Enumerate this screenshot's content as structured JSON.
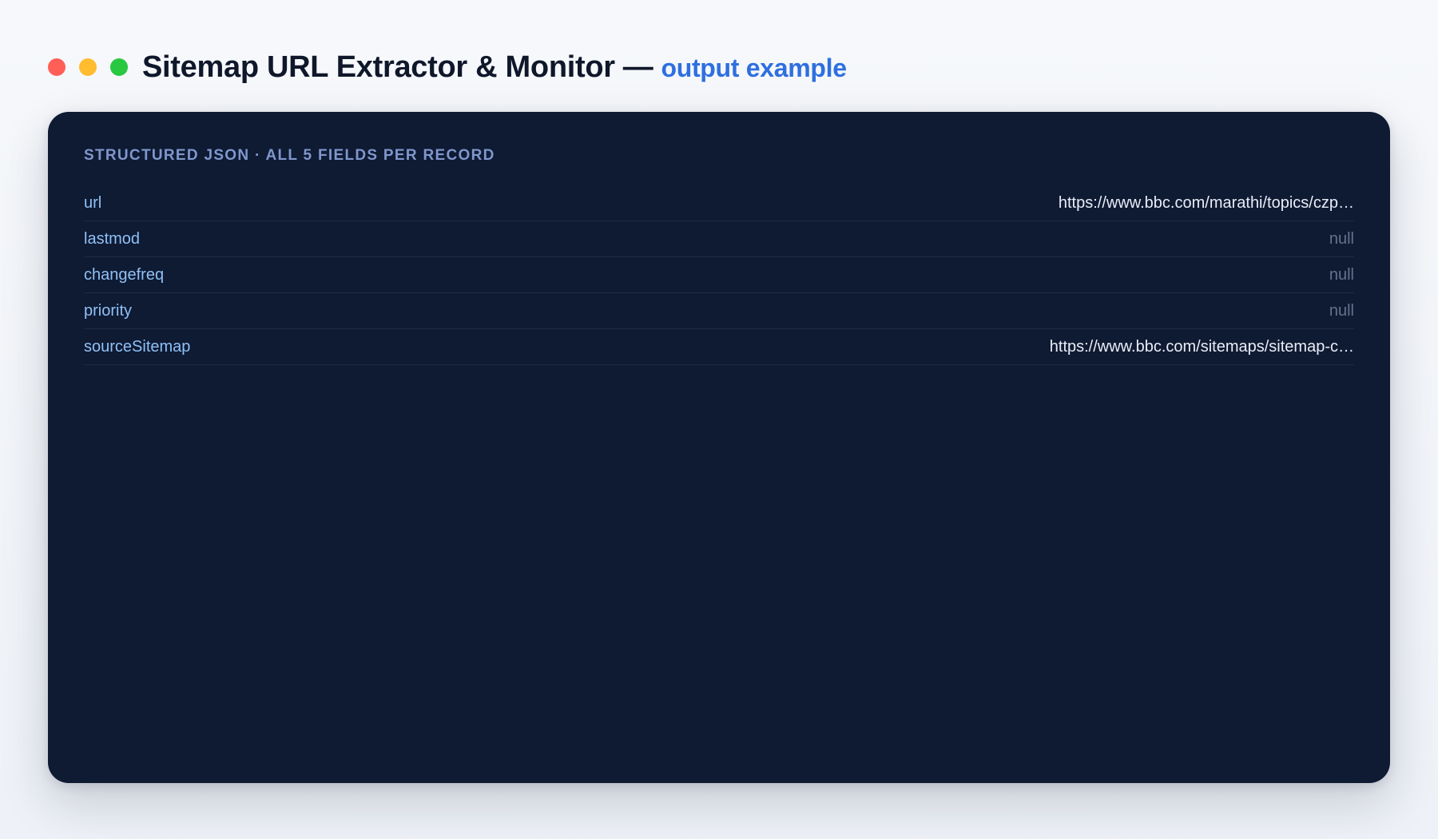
{
  "window": {
    "title": "Sitemap URL Extractor & Monitor",
    "separator": "—",
    "subtitle": "output example",
    "controls": [
      "close",
      "minimize",
      "maximize"
    ]
  },
  "colors": {
    "close": "#ff5f57",
    "minimize": "#febc2e",
    "maximize": "#28c840",
    "accent": "#2f6fe0",
    "panel": "#0f1a33"
  },
  "panel": {
    "heading": "STRUCTURED JSON · ALL 5 FIELDS PER RECORD",
    "fields": [
      {
        "key": "url",
        "value": "https://www.bbc.com/marathi/topics/czp…",
        "is_null": false
      },
      {
        "key": "lastmod",
        "value": "null",
        "is_null": true
      },
      {
        "key": "changefreq",
        "value": "null",
        "is_null": true
      },
      {
        "key": "priority",
        "value": "null",
        "is_null": true
      },
      {
        "key": "sourceSitemap",
        "value": "https://www.bbc.com/sitemaps/sitemap-c…",
        "is_null": false
      }
    ]
  }
}
